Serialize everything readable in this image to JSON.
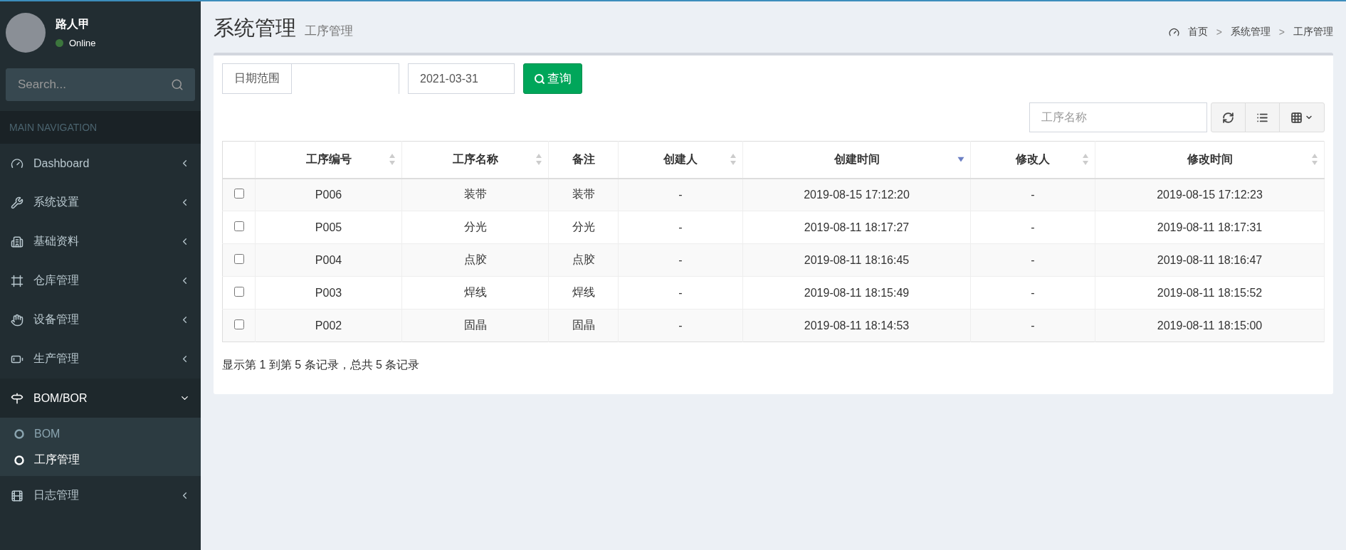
{
  "user": {
    "name": "路人甲",
    "status": "Online",
    "online": true
  },
  "sidebar": {
    "search": {
      "placeholder": "Search..."
    },
    "header": "MAIN NAVIGATION",
    "items": [
      {
        "label": "Dashboard",
        "expanded": false
      },
      {
        "label": "系统设置",
        "expanded": false
      },
      {
        "label": "基础资料",
        "expanded": false
      },
      {
        "label": "仓库管理",
        "expanded": false
      },
      {
        "label": "设备管理",
        "expanded": false
      },
      {
        "label": "生产管理",
        "expanded": false
      },
      {
        "label": "BOM/BOR",
        "expanded": true,
        "children": [
          {
            "label": "BOM",
            "selected": false
          },
          {
            "label": "工序管理",
            "selected": true
          }
        ]
      },
      {
        "label": "日志管理",
        "expanded": false
      }
    ]
  },
  "page": {
    "title": "系统管理",
    "subtitle": "工序管理",
    "breadcrumb": [
      "首页",
      "系统管理",
      "工序管理"
    ],
    "breadcrumb_separators": [
      ">",
      ">"
    ]
  },
  "filters": {
    "date_label": "日期范围",
    "date_end": {
      "value": "2021-03-31"
    },
    "query_button": "查询"
  },
  "toolbar": {
    "search": {
      "placeholder": "工序名称"
    }
  },
  "table": {
    "columns": [
      {
        "label": "工序编号",
        "sortable": true,
        "sorted": false
      },
      {
        "label": "工序名称",
        "sortable": true,
        "sorted": false
      },
      {
        "label": "备注",
        "sortable": false
      },
      {
        "label": "创建人",
        "sortable": true,
        "sorted": false
      },
      {
        "label": "创建时间",
        "sortable": true,
        "sorted": true
      },
      {
        "label": "修改人",
        "sortable": true,
        "sorted": false
      },
      {
        "label": "修改时间",
        "sortable": true,
        "sorted": false
      }
    ],
    "rows": [
      {
        "checked": false,
        "cells": [
          "P006",
          "装带",
          "装带",
          "-",
          "2019-08-15 17:12:20",
          "-",
          "2019-08-15 17:12:23"
        ]
      },
      {
        "checked": false,
        "cells": [
          "P005",
          "分光",
          "分光",
          "-",
          "2019-08-11 18:17:27",
          "-",
          "2019-08-11 18:17:31"
        ]
      },
      {
        "checked": false,
        "cells": [
          "P004",
          "点胶",
          "点胶",
          "-",
          "2019-08-11 18:16:45",
          "-",
          "2019-08-11 18:16:47"
        ]
      },
      {
        "checked": false,
        "cells": [
          "P003",
          "焊线",
          "焊线",
          "-",
          "2019-08-11 18:15:49",
          "-",
          "2019-08-11 18:15:52"
        ]
      },
      {
        "checked": false,
        "cells": [
          "P002",
          "固晶",
          "固晶",
          "-",
          "2019-08-11 18:14:53",
          "-",
          "2019-08-11 18:15:00"
        ]
      }
    ]
  },
  "pagination": {
    "summary": "显示第 1 到第 5 条记录，总共 5 条记录"
  }
}
